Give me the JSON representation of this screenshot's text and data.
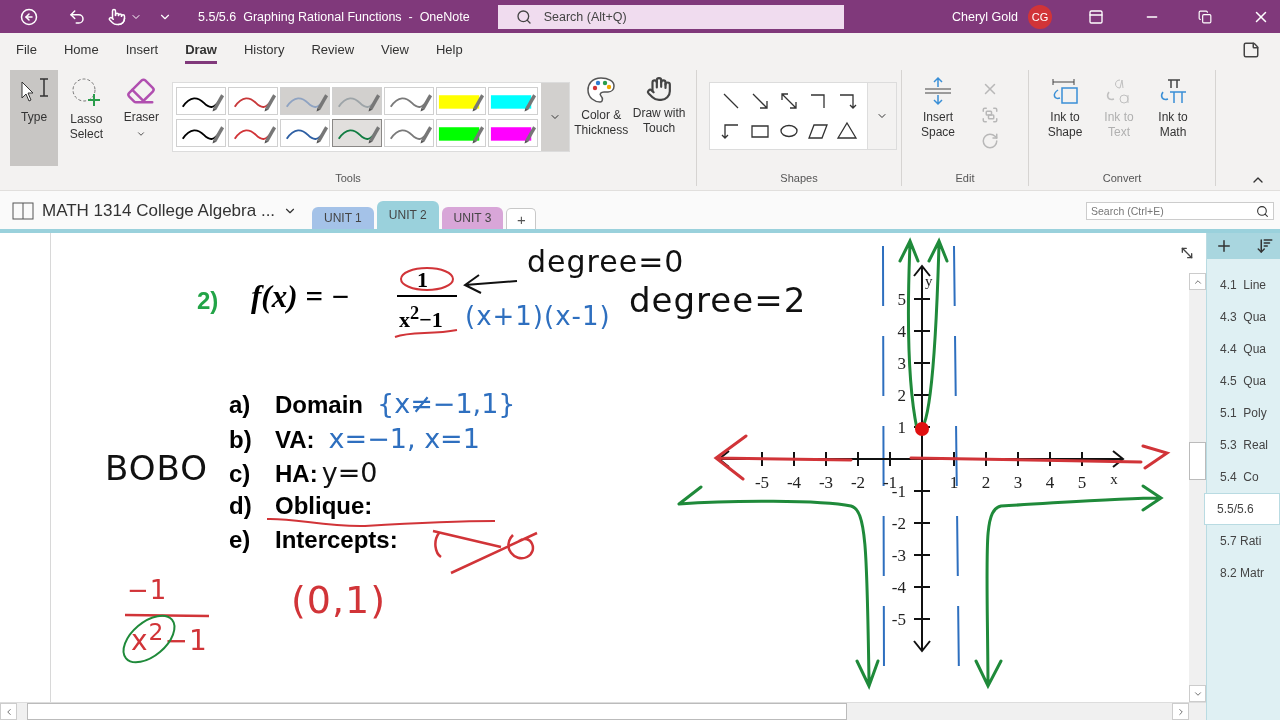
{
  "title_bar": {
    "title": "5.5/5.6  Graphing Rational Functions  -  OneNote",
    "search": {
      "placeholder": "Search (Alt+Q)"
    },
    "user": "Cheryl Gold",
    "initials": "CG"
  },
  "menu_tabs": [
    {
      "label": "File",
      "selected": false
    },
    {
      "label": "Home",
      "selected": false
    },
    {
      "label": "Insert",
      "selected": false
    },
    {
      "label": "Draw",
      "selected": true
    },
    {
      "label": "History",
      "selected": false
    },
    {
      "label": "Review",
      "selected": false
    },
    {
      "label": "View",
      "selected": false
    },
    {
      "label": "Help",
      "selected": false
    }
  ],
  "ribbon": {
    "tools_group": {
      "label": "Tools",
      "tools": [
        {
          "kind": "type",
          "label": "Type",
          "selected": true
        },
        {
          "kind": "lasso",
          "label": "Lasso Select",
          "selected": false
        },
        {
          "kind": "eraser",
          "label": "Eraser",
          "selected": false
        }
      ],
      "pens": [
        {
          "kind": "pen",
          "color": "#000000",
          "selected": false,
          "dimmed": false
        },
        {
          "kind": "pen",
          "color": "#c8383a",
          "selected": false,
          "dimmed": false
        },
        {
          "kind": "pen",
          "color": "#8fa3c2",
          "selected": false,
          "dimmed": true
        },
        {
          "kind": "pen",
          "color": "#9da4a8",
          "selected": false,
          "dimmed": true
        },
        {
          "kind": "pen",
          "color": "#7a7a7a",
          "selected": false,
          "dimmed": false
        },
        {
          "kind": "highlighter",
          "color": "#ffff00",
          "selected": false,
          "dimmed": false
        },
        {
          "kind": "highlighter",
          "color": "#00ffff",
          "selected": false,
          "dimmed": false
        },
        {
          "kind": "pen",
          "color": "#000000",
          "selected": false,
          "dimmed": false
        },
        {
          "kind": "pen",
          "color": "#d13438",
          "selected": false,
          "dimmed": false
        },
        {
          "kind": "pen",
          "color": "#2e5fa3",
          "selected": false,
          "dimmed": false
        },
        {
          "kind": "pen",
          "color": "#107c41",
          "selected": true,
          "dimmed": false
        },
        {
          "kind": "pen",
          "color": "#7a7a7a",
          "selected": false,
          "dimmed": false
        },
        {
          "kind": "highlighter",
          "color": "#00ff00",
          "selected": false,
          "dimmed": false
        },
        {
          "kind": "highlighter",
          "color": "#ff00ff",
          "selected": false,
          "dimmed": false
        }
      ],
      "extras": [
        {
          "kind": "palette",
          "label": "Color & Thickness"
        },
        {
          "kind": "touch",
          "label": "Draw with Touch"
        }
      ]
    },
    "shapes_group": {
      "label": "Shapes"
    },
    "edit_group": {
      "label": "Edit",
      "insert_space": "Insert Space"
    },
    "convert_group": {
      "label": "Convert",
      "buttons": [
        {
          "kind": "shape",
          "label": "Ink to Shape",
          "disabled": false
        },
        {
          "kind": "text",
          "label": "Ink to Text",
          "disabled": true
        },
        {
          "kind": "math",
          "label": "Ink to Math",
          "disabled": false
        }
      ]
    }
  },
  "notebook": {
    "name": "MATH 1314 College Algebra ...",
    "sections": [
      {
        "label": "UNIT 1",
        "color": "#a4c2e8",
        "selected": false
      },
      {
        "label": "UNIT 2",
        "color": "#9ad1dc",
        "selected": true
      },
      {
        "label": "UNIT 3",
        "color": "#d8a6d8",
        "selected": false
      }
    ],
    "add_section": "+",
    "search": {
      "placeholder": "Search (Ctrl+E)"
    }
  },
  "page": {
    "problem": {
      "number": "2)",
      "function": "f(x) = −",
      "numerator": "1",
      "denominator": "x$^{2}$−1"
    },
    "notes": {
      "degree_top": "degree=0",
      "factored": "(x+1)(x-1)",
      "degree_bottom": "degree=2",
      "bobo": "BOBO",
      "side_numerator": "−1",
      "side_denominator": "x$^{2}$−1",
      "intercept": "(0,1)"
    },
    "items": [
      {
        "marker": "a)",
        "label": "Domain",
        "answer": "{x≠−1,1}",
        "struck": false
      },
      {
        "marker": "b)",
        "label": "VA:",
        "answer": "x=−1, x=1",
        "struck": false
      },
      {
        "marker": "c)",
        "label": "HA:",
        "answer": "y=0",
        "struck": false
      },
      {
        "marker": "d)",
        "label": "Oblique:",
        "struck": true
      },
      {
        "marker": "e)",
        "label": "Intercepts:",
        "struck": false
      }
    ],
    "graph": {
      "x_ticks": [
        "-5",
        "-4",
        "-3",
        "-2",
        "-1",
        "1",
        "2",
        "3",
        "4",
        "5"
      ],
      "y_ticks": [
        "5",
        "4",
        "3",
        "2",
        "1",
        "-1",
        "-2",
        "-3",
        "-4",
        "-5"
      ],
      "x_label": "x",
      "y_label": "y"
    }
  },
  "pages": [
    {
      "label": "4.1  Line",
      "selected": false
    },
    {
      "label": "4.3  Qua",
      "selected": false
    },
    {
      "label": "4.4  Qua",
      "selected": false
    },
    {
      "label": "4.5  Qua",
      "selected": false
    },
    {
      "label": "5.1  Poly",
      "selected": false
    },
    {
      "label": "5.3  Real",
      "selected": false
    },
    {
      "label": "5.4  Co",
      "selected": false
    },
    {
      "label": "5.5/5.6",
      "selected": true
    },
    {
      "label": "5.7 Rati",
      "selected": false
    },
    {
      "label": "8.2 Matr",
      "selected": false
    }
  ]
}
